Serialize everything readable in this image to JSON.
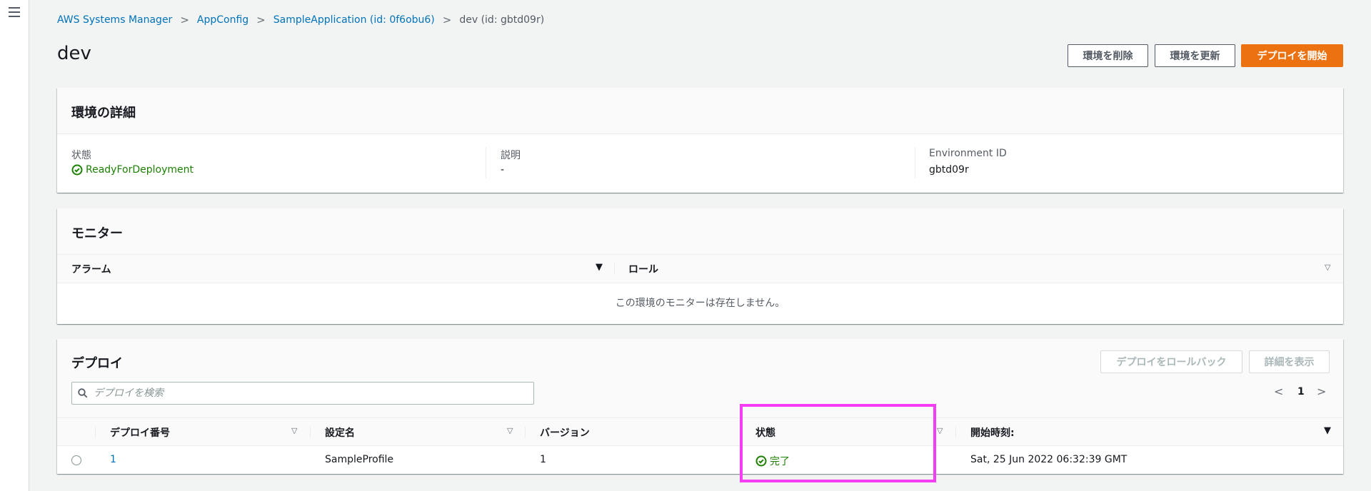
{
  "breadcrumb": {
    "items": [
      "AWS Systems Manager",
      "AppConfig",
      "SampleApplication (id: 0f6obu6)"
    ],
    "current": "dev (id: gbtd09r)"
  },
  "page": {
    "title": "dev"
  },
  "actions": {
    "delete_env": "環境を削除",
    "update_env": "環境を更新",
    "start_deploy": "デプロイを開始"
  },
  "details": {
    "title": "環境の詳細",
    "status_label": "状態",
    "status_value": "ReadyForDeployment",
    "description_label": "説明",
    "description_value": "-",
    "env_id_label": "Environment ID",
    "env_id_value": "gbtd09r"
  },
  "monitor": {
    "title": "モニター",
    "col_alarm": "アラーム",
    "col_role": "ロール",
    "empty_message": "この環境のモニターは存在しません。"
  },
  "deploy": {
    "title": "デプロイ",
    "rollback_button": "デプロイをロールバック",
    "details_button": "詳細を表示",
    "search_placeholder": "デプロイを検索",
    "page_number": "1",
    "columns": {
      "number": "デプロイ番号",
      "config": "設定名",
      "version": "バージョン",
      "status": "状態",
      "start_time": "開始時刻:"
    },
    "rows": [
      {
        "number": "1",
        "config": "SampleProfile",
        "version": "1",
        "status": "完了",
        "start_time": "Sat, 25 Jun 2022 06:32:39 GMT"
      }
    ]
  },
  "colors": {
    "accent": "#ec7211",
    "link": "#0073bb",
    "success": "#1d8102",
    "highlight": "#f53df5"
  },
  "icons": [
    "menu-icon",
    "chevron-right-icon",
    "check-circle-icon",
    "search-icon",
    "sort-down-icon",
    "chevron-left-icon"
  ]
}
